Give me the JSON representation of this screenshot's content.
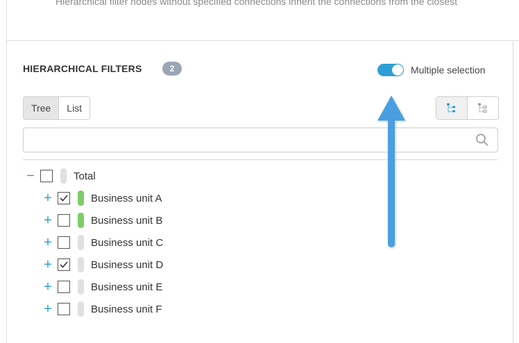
{
  "top": {
    "note": "Hierarchical filter nodes without specified connections inherit the connections from the closest"
  },
  "panel": {
    "title": "HIERARCHICAL FILTERS",
    "badge": "2",
    "toggle_label": "Multiple selection",
    "toggle_on": true,
    "view_tabs": [
      "Tree",
      "List"
    ],
    "active_view": "Tree",
    "search": {
      "value": "",
      "placeholder": ""
    }
  },
  "tree": [
    {
      "label": "Total",
      "expander": "minus",
      "checked": false,
      "flag": "grey"
    },
    {
      "label": "Business unit A",
      "expander": "plus",
      "checked": true,
      "flag": "green"
    },
    {
      "label": "Business unit B",
      "expander": "plus",
      "checked": false,
      "flag": "green"
    },
    {
      "label": "Business unit C",
      "expander": "plus",
      "checked": false,
      "flag": "grey"
    },
    {
      "label": "Business unit D",
      "expander": "plus",
      "checked": true,
      "flag": "grey"
    },
    {
      "label": "Business unit E",
      "expander": "plus",
      "checked": false,
      "flag": "grey"
    },
    {
      "label": "Business unit F",
      "expander": "plus",
      "checked": false,
      "flag": "grey"
    }
  ],
  "colors": {
    "accent": "#2e9fd4",
    "flag_green": "#7dcc6a",
    "flag_grey": "#e0e0e0",
    "badge_bg": "#9aa6b2",
    "annotation_arrow": "#4a9fe0"
  },
  "icons": {
    "search": "search-icon",
    "expand_tree": "tree-expand-icon",
    "collapse_tree": "tree-collapse-icon",
    "annotation": "annotation-arrow-icon"
  }
}
